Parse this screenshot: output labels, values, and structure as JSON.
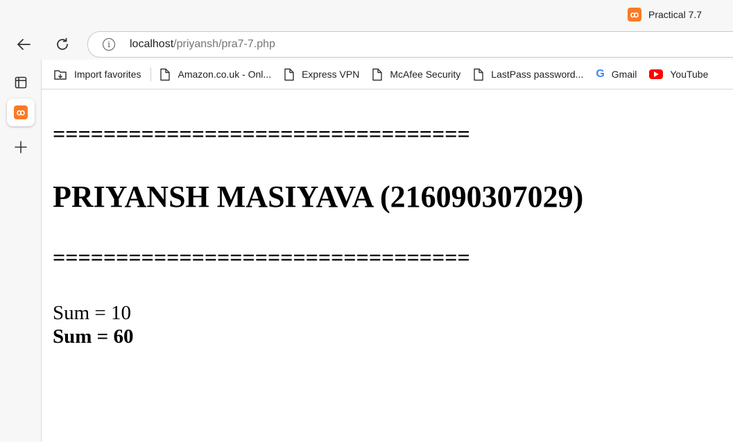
{
  "tab": {
    "title": "Practical 7.7",
    "icon": "xampp-icon"
  },
  "address_bar": {
    "host": "localhost",
    "path": "/priyansh/pra7-7.php",
    "icon": "info-icon"
  },
  "favorites": [
    {
      "label": "Import favorites",
      "icon": "import-favorites-icon"
    },
    {
      "label": "Amazon.co.uk - Onl...",
      "icon": "page-icon"
    },
    {
      "label": "Express VPN",
      "icon": "page-icon"
    },
    {
      "label": "McAfee Security",
      "icon": "page-icon"
    },
    {
      "label": "LastPass password...",
      "icon": "page-icon"
    },
    {
      "label": "Gmail",
      "icon": "google-icon"
    },
    {
      "label": "YouTube",
      "icon": "youtube-icon"
    }
  ],
  "page": {
    "rule_top": "=================================",
    "heading": "PRIYANSH MASIYAVA (216090307029)",
    "rule_bottom": "=================================",
    "sum_plain": "Sum = 10",
    "sum_bold": "Sum = 60"
  },
  "colors": {
    "xampp_orange": "#fb7a24",
    "youtube_red": "#ff0000"
  }
}
